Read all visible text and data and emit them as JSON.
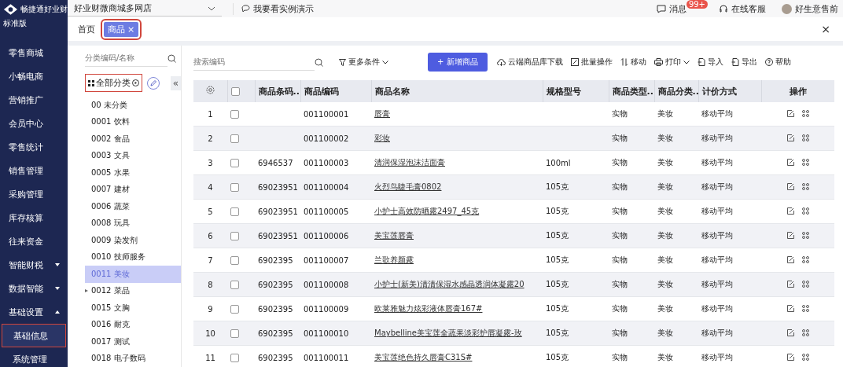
{
  "brand": {
    "name": "畅捷通好业财",
    "edition": "标准版"
  },
  "nav": [
    {
      "label": "零售商城",
      "selected": false
    },
    {
      "label": "小畅电商",
      "selected": false
    },
    {
      "label": "营销推广",
      "selected": false
    },
    {
      "label": "会员中心",
      "selected": false
    },
    {
      "label": "零售统计",
      "selected": false
    },
    {
      "label": "销售管理",
      "selected": false
    },
    {
      "label": "采购管理",
      "selected": false
    },
    {
      "label": "库存核算",
      "selected": false
    },
    {
      "label": "往来资金",
      "selected": false
    },
    {
      "label": "智能财税",
      "selected": false,
      "expanded": false
    },
    {
      "label": "数据智能",
      "selected": false,
      "expanded": false
    },
    {
      "label": "基础设置",
      "selected": false,
      "expanded": true,
      "children": [
        {
          "label": "基础信息",
          "selected": true
        },
        {
          "label": "系统管理",
          "selected": false
        }
      ]
    }
  ],
  "topbar": {
    "store": "好业财微商城多网店",
    "demo": "我要看实例演示",
    "messages": "消息",
    "badge": "99+",
    "service": "在线客服",
    "user": "好生意售前"
  },
  "tabs": [
    {
      "label": "首页",
      "selected": false
    },
    {
      "label": "商品",
      "selected": true,
      "close": "×"
    }
  ],
  "close_all": "×",
  "category": {
    "placeholder": "分类编码/名称",
    "root": "全部分类",
    "collapse": "«",
    "items": [
      {
        "label": "00 未分类",
        "selected": false
      },
      {
        "label": "0001 饮料",
        "selected": false
      },
      {
        "label": "0002 食品",
        "selected": false
      },
      {
        "label": "0003 文具",
        "selected": false
      },
      {
        "label": "0005 水果",
        "selected": false
      },
      {
        "label": "0007 建材",
        "selected": false
      },
      {
        "label": "0006 蔬菜",
        "selected": false
      },
      {
        "label": "0008 玩具",
        "selected": false
      },
      {
        "label": "0009 染发剂",
        "selected": false
      },
      {
        "label": "0010 技师服务",
        "selected": false
      },
      {
        "label": "0011 美妆",
        "selected": true
      },
      {
        "label": "0012 菜品",
        "selected": false,
        "expanded": false
      },
      {
        "label": "0015 文胸",
        "selected": false
      },
      {
        "label": "0016 耐克",
        "selected": false
      },
      {
        "label": "0017 测试",
        "selected": false
      },
      {
        "label": "0018 电子数码",
        "selected": false
      }
    ]
  },
  "toolbar": {
    "placeholder": "搜索编码",
    "filter": "更多条件",
    "add": "+ 新增商品",
    "actions": [
      {
        "label": "云端商品库下载",
        "kind": "cloud"
      },
      {
        "label": "批量操作",
        "kind": "edit"
      },
      {
        "label": "移动",
        "kind": "move"
      },
      {
        "label": "打印",
        "kind": "print"
      },
      {
        "label": "导入",
        "kind": "import"
      },
      {
        "label": "导出",
        "kind": "export"
      },
      {
        "label": "帮助",
        "kind": "help"
      }
    ]
  },
  "table": {
    "header_checked": false,
    "columns": [
      "商品条码..",
      "商品编码",
      "商品名称",
      "规格型号",
      "商品类型..",
      "商品分类..",
      "计价方式",
      "操作"
    ],
    "rows": [
      {
        "no": "1",
        "checked": false,
        "barcode": "",
        "code": "001100001",
        "name": "唇膏",
        "spec": "",
        "type": "实物",
        "category": "美妆",
        "pricing": "移动平均"
      },
      {
        "no": "2",
        "checked": false,
        "barcode": "",
        "code": "001100002",
        "name": "彩妆",
        "spec": "",
        "type": "实物",
        "category": "美妆",
        "pricing": "移动平均"
      },
      {
        "no": "3",
        "checked": false,
        "barcode": "6946537",
        "code": "001100003",
        "name": "清润保湿泡沫洁面膏",
        "spec": "100ml",
        "type": "实物",
        "category": "美妆",
        "pricing": "移动平均"
      },
      {
        "no": "4",
        "checked": false,
        "barcode": "69023951",
        "code": "001100004",
        "name": "火烈鸟睫毛膏0802",
        "spec": "105克",
        "type": "实物",
        "category": "美妆",
        "pricing": "移动平均"
      },
      {
        "no": "5",
        "checked": false,
        "barcode": "69023951",
        "code": "001100005",
        "name": "小护士高效防晒露2497_45克",
        "spec": "105克",
        "type": "实物",
        "category": "美妆",
        "pricing": "移动平均"
      },
      {
        "no": "6",
        "checked": false,
        "barcode": "69023951",
        "code": "001100006",
        "name": "美宝莲唇膏",
        "spec": "105克",
        "type": "实物",
        "category": "美妆",
        "pricing": "移动平均"
      },
      {
        "no": "7",
        "checked": false,
        "barcode": "6902395",
        "code": "001100007",
        "name": "兰歌养颜露",
        "spec": "105克",
        "type": "实物",
        "category": "美妆",
        "pricing": "移动平均"
      },
      {
        "no": "8",
        "checked": false,
        "barcode": "6902395",
        "code": "001100008",
        "name": "小护士(新美)清清保湿水感晶透润体凝露20",
        "spec": "105克",
        "type": "实物",
        "category": "美妆",
        "pricing": "移动平均"
      },
      {
        "no": "9",
        "checked": false,
        "barcode": "6902395",
        "code": "001100009",
        "name": "欧莱雅魅力炫彩液体唇膏167#",
        "spec": "105克",
        "type": "实物",
        "category": "美妆",
        "pricing": "移动平均"
      },
      {
        "no": "10",
        "checked": false,
        "barcode": "6902395",
        "code": "001100010",
        "name": "Maybelline美宝莲全蔬果淡彩护唇凝露-玫",
        "spec": "105克",
        "type": "实物",
        "category": "美妆",
        "pricing": "移动平均"
      },
      {
        "no": "11",
        "checked": false,
        "barcode": "6902395",
        "code": "001100011",
        "name": "美宝莲绝色持久唇膏C31S#",
        "spec": "105克",
        "type": "实物",
        "category": "美妆",
        "pricing": "移动平均"
      }
    ]
  }
}
